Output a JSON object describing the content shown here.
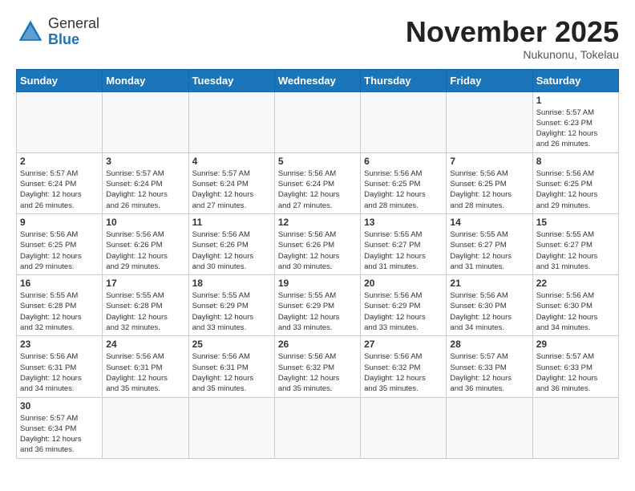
{
  "header": {
    "logo_general": "General",
    "logo_blue": "Blue",
    "month_title": "November 2025",
    "location": "Nukunonu, Tokelau"
  },
  "days_of_week": [
    "Sunday",
    "Monday",
    "Tuesday",
    "Wednesday",
    "Thursday",
    "Friday",
    "Saturday"
  ],
  "weeks": [
    [
      {
        "day": "",
        "empty": true
      },
      {
        "day": "",
        "empty": true
      },
      {
        "day": "",
        "empty": true
      },
      {
        "day": "",
        "empty": true
      },
      {
        "day": "",
        "empty": true
      },
      {
        "day": "",
        "empty": true
      },
      {
        "day": "1",
        "info": "Sunrise: 5:57 AM\nSunset: 6:23 PM\nDaylight: 12 hours\nand 26 minutes."
      }
    ],
    [
      {
        "day": "2",
        "info": "Sunrise: 5:57 AM\nSunset: 6:24 PM\nDaylight: 12 hours\nand 26 minutes."
      },
      {
        "day": "3",
        "info": "Sunrise: 5:57 AM\nSunset: 6:24 PM\nDaylight: 12 hours\nand 26 minutes."
      },
      {
        "day": "4",
        "info": "Sunrise: 5:57 AM\nSunset: 6:24 PM\nDaylight: 12 hours\nand 27 minutes."
      },
      {
        "day": "5",
        "info": "Sunrise: 5:56 AM\nSunset: 6:24 PM\nDaylight: 12 hours\nand 27 minutes."
      },
      {
        "day": "6",
        "info": "Sunrise: 5:56 AM\nSunset: 6:25 PM\nDaylight: 12 hours\nand 28 minutes."
      },
      {
        "day": "7",
        "info": "Sunrise: 5:56 AM\nSunset: 6:25 PM\nDaylight: 12 hours\nand 28 minutes."
      },
      {
        "day": "8",
        "info": "Sunrise: 5:56 AM\nSunset: 6:25 PM\nDaylight: 12 hours\nand 29 minutes."
      }
    ],
    [
      {
        "day": "9",
        "info": "Sunrise: 5:56 AM\nSunset: 6:25 PM\nDaylight: 12 hours\nand 29 minutes."
      },
      {
        "day": "10",
        "info": "Sunrise: 5:56 AM\nSunset: 6:26 PM\nDaylight: 12 hours\nand 29 minutes."
      },
      {
        "day": "11",
        "info": "Sunrise: 5:56 AM\nSunset: 6:26 PM\nDaylight: 12 hours\nand 30 minutes."
      },
      {
        "day": "12",
        "info": "Sunrise: 5:56 AM\nSunset: 6:26 PM\nDaylight: 12 hours\nand 30 minutes."
      },
      {
        "day": "13",
        "info": "Sunrise: 5:55 AM\nSunset: 6:27 PM\nDaylight: 12 hours\nand 31 minutes."
      },
      {
        "day": "14",
        "info": "Sunrise: 5:55 AM\nSunset: 6:27 PM\nDaylight: 12 hours\nand 31 minutes."
      },
      {
        "day": "15",
        "info": "Sunrise: 5:55 AM\nSunset: 6:27 PM\nDaylight: 12 hours\nand 31 minutes."
      }
    ],
    [
      {
        "day": "16",
        "info": "Sunrise: 5:55 AM\nSunset: 6:28 PM\nDaylight: 12 hours\nand 32 minutes."
      },
      {
        "day": "17",
        "info": "Sunrise: 5:55 AM\nSunset: 6:28 PM\nDaylight: 12 hours\nand 32 minutes."
      },
      {
        "day": "18",
        "info": "Sunrise: 5:55 AM\nSunset: 6:29 PM\nDaylight: 12 hours\nand 33 minutes."
      },
      {
        "day": "19",
        "info": "Sunrise: 5:55 AM\nSunset: 6:29 PM\nDaylight: 12 hours\nand 33 minutes."
      },
      {
        "day": "20",
        "info": "Sunrise: 5:56 AM\nSunset: 6:29 PM\nDaylight: 12 hours\nand 33 minutes."
      },
      {
        "day": "21",
        "info": "Sunrise: 5:56 AM\nSunset: 6:30 PM\nDaylight: 12 hours\nand 34 minutes."
      },
      {
        "day": "22",
        "info": "Sunrise: 5:56 AM\nSunset: 6:30 PM\nDaylight: 12 hours\nand 34 minutes."
      }
    ],
    [
      {
        "day": "23",
        "info": "Sunrise: 5:56 AM\nSunset: 6:31 PM\nDaylight: 12 hours\nand 34 minutes."
      },
      {
        "day": "24",
        "info": "Sunrise: 5:56 AM\nSunset: 6:31 PM\nDaylight: 12 hours\nand 35 minutes."
      },
      {
        "day": "25",
        "info": "Sunrise: 5:56 AM\nSunset: 6:31 PM\nDaylight: 12 hours\nand 35 minutes."
      },
      {
        "day": "26",
        "info": "Sunrise: 5:56 AM\nSunset: 6:32 PM\nDaylight: 12 hours\nand 35 minutes."
      },
      {
        "day": "27",
        "info": "Sunrise: 5:56 AM\nSunset: 6:32 PM\nDaylight: 12 hours\nand 35 minutes."
      },
      {
        "day": "28",
        "info": "Sunrise: 5:57 AM\nSunset: 6:33 PM\nDaylight: 12 hours\nand 36 minutes."
      },
      {
        "day": "29",
        "info": "Sunrise: 5:57 AM\nSunset: 6:33 PM\nDaylight: 12 hours\nand 36 minutes."
      }
    ],
    [
      {
        "day": "30",
        "info": "Sunrise: 5:57 AM\nSunset: 6:34 PM\nDaylight: 12 hours\nand 36 minutes."
      },
      {
        "day": "",
        "empty": true
      },
      {
        "day": "",
        "empty": true
      },
      {
        "day": "",
        "empty": true
      },
      {
        "day": "",
        "empty": true
      },
      {
        "day": "",
        "empty": true
      },
      {
        "day": "",
        "empty": true
      }
    ]
  ]
}
